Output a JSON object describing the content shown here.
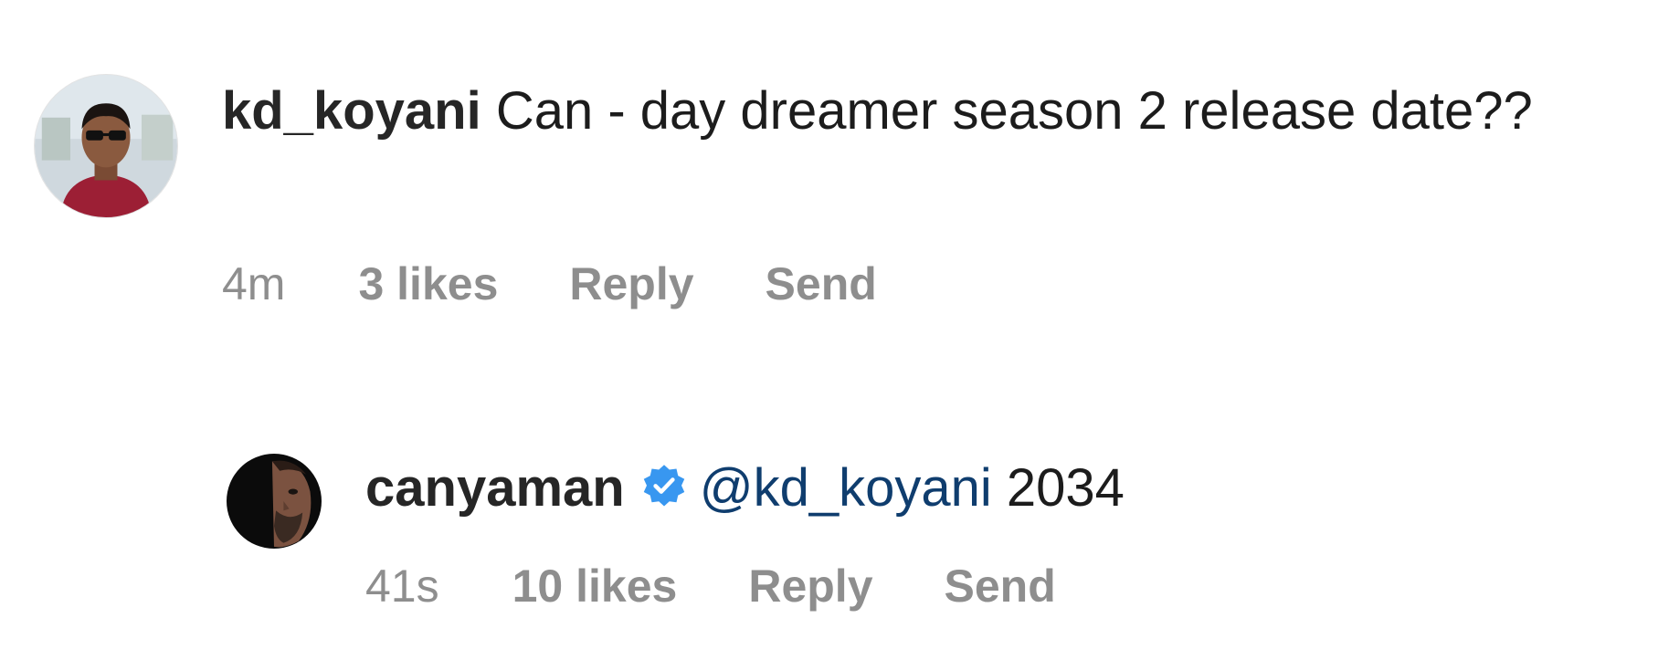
{
  "comment": {
    "username": "kd_koyani",
    "text": "Can - day dreamer season 2 release date??",
    "time": "4m",
    "likes": "3 likes",
    "reply_label": "Reply",
    "send_label": "Send"
  },
  "reply": {
    "username": "canyaman",
    "verified": true,
    "mention": "@kd_koyani",
    "text": "2034",
    "time": "41s",
    "likes": "10 likes",
    "reply_label": "Reply",
    "send_label": "Send"
  },
  "colors": {
    "mention": "#0f3d6e",
    "verified_badge": "#3897f0",
    "meta_text": "#8e8e8e"
  },
  "icons": {
    "verified": "verified-badge-icon"
  }
}
